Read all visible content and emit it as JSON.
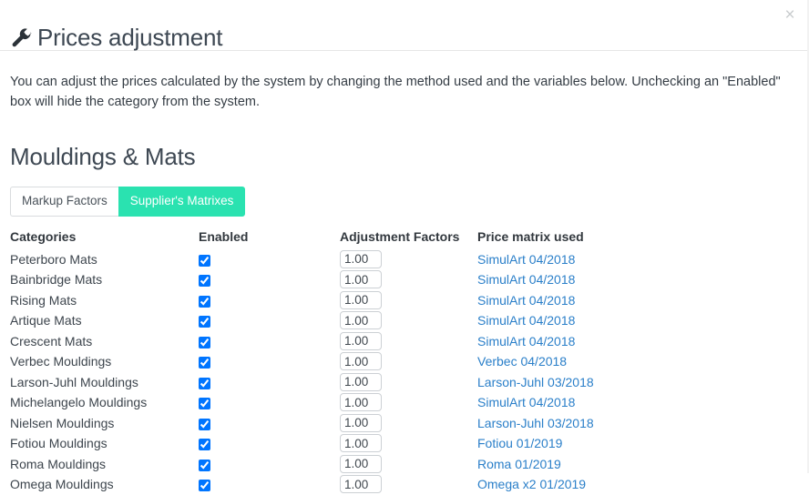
{
  "header": {
    "title": "Prices adjustment",
    "icon": "wrench-icon",
    "close_label": "×"
  },
  "intro": "You can adjust the prices calculated by the system by changing the method used and the variables below. Unchecking an \"Enabled\" box will hide the category from the system.",
  "section": {
    "title": "Mouldings & Mats"
  },
  "tabs": [
    {
      "label": "Markup Factors",
      "active": false
    },
    {
      "label": "Supplier's Matrixes",
      "active": true
    }
  ],
  "colors": {
    "tab_active_bg": "#2ae2b0",
    "link": "#2a7fc9",
    "text": "#3a4149",
    "heading": "#3e4853",
    "border": "#d9dcde"
  },
  "table": {
    "columns": [
      "Categories",
      "Enabled",
      "Adjustment Factors",
      "Price matrix used"
    ],
    "rows": [
      {
        "category": "Peterboro Mats",
        "enabled": true,
        "factor": "1.00",
        "matrix": "SimulArt 04/2018"
      },
      {
        "category": "Bainbridge Mats",
        "enabled": true,
        "factor": "1.00",
        "matrix": "SimulArt 04/2018"
      },
      {
        "category": "Rising Mats",
        "enabled": true,
        "factor": "1.00",
        "matrix": "SimulArt 04/2018"
      },
      {
        "category": "Artique Mats",
        "enabled": true,
        "factor": "1.00",
        "matrix": "SimulArt 04/2018"
      },
      {
        "category": "Crescent Mats",
        "enabled": true,
        "factor": "1.00",
        "matrix": "SimulArt 04/2018"
      },
      {
        "category": "Verbec Mouldings",
        "enabled": true,
        "factor": "1.00",
        "matrix": "Verbec 04/2018"
      },
      {
        "category": "Larson-Juhl Mouldings",
        "enabled": true,
        "factor": "1.00",
        "matrix": "Larson-Juhl 03/2018"
      },
      {
        "category": "Michelangelo Mouldings",
        "enabled": true,
        "factor": "1.00",
        "matrix": "SimulArt 04/2018"
      },
      {
        "category": "Nielsen Mouldings",
        "enabled": true,
        "factor": "1.00",
        "matrix": "Larson-Juhl 03/2018"
      },
      {
        "category": "Fotiou Mouldings",
        "enabled": true,
        "factor": "1.00",
        "matrix": "Fotiou 01/2019"
      },
      {
        "category": "Roma Mouldings",
        "enabled": true,
        "factor": "1.00",
        "matrix": "Roma 01/2019"
      },
      {
        "category": "Omega Mouldings",
        "enabled": true,
        "factor": "1.00",
        "matrix": "Omega x2 01/2019"
      }
    ]
  }
}
